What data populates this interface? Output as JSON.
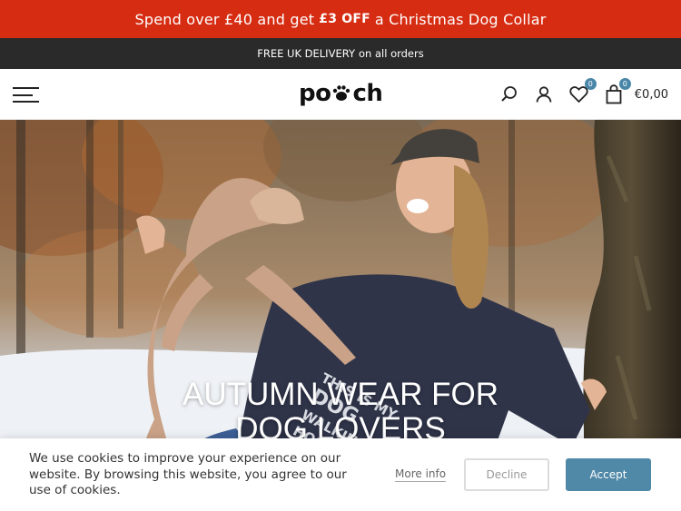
{
  "promo": {
    "before": "Spend over £40 and get",
    "highlight": "£3 OFF",
    "after": "a Christmas Dog Collar"
  },
  "delivery": {
    "strong": "FREE UK DELIVERY",
    "rest": "on all orders"
  },
  "header": {
    "logo": "pooch",
    "logo_prefix": "po",
    "logo_suffix": "ch",
    "wishlist_count": "0",
    "cart_count": "0",
    "cart_total": "€0,00"
  },
  "hero": {
    "title_line1": "AUTUMN WEAR FOR",
    "title_line2": "DOG LOVERS",
    "hoodie_text": "THIS IS MY DOG WALKING HOODIE"
  },
  "cookie": {
    "text": "We use cookies to improve your experience on our website. By browsing this website, you agree to our use of cookies.",
    "more_info": "More info",
    "decline": "Decline",
    "accept": "Accept"
  },
  "colors": {
    "promo_bg": "#d62c12",
    "delivery_bg": "#2a2a2a",
    "badge": "#4a86a8",
    "accept_bg": "#5088a7"
  },
  "icons": [
    "menu-icon",
    "paw-icon",
    "search-icon",
    "user-icon",
    "heart-icon",
    "bag-icon"
  ]
}
